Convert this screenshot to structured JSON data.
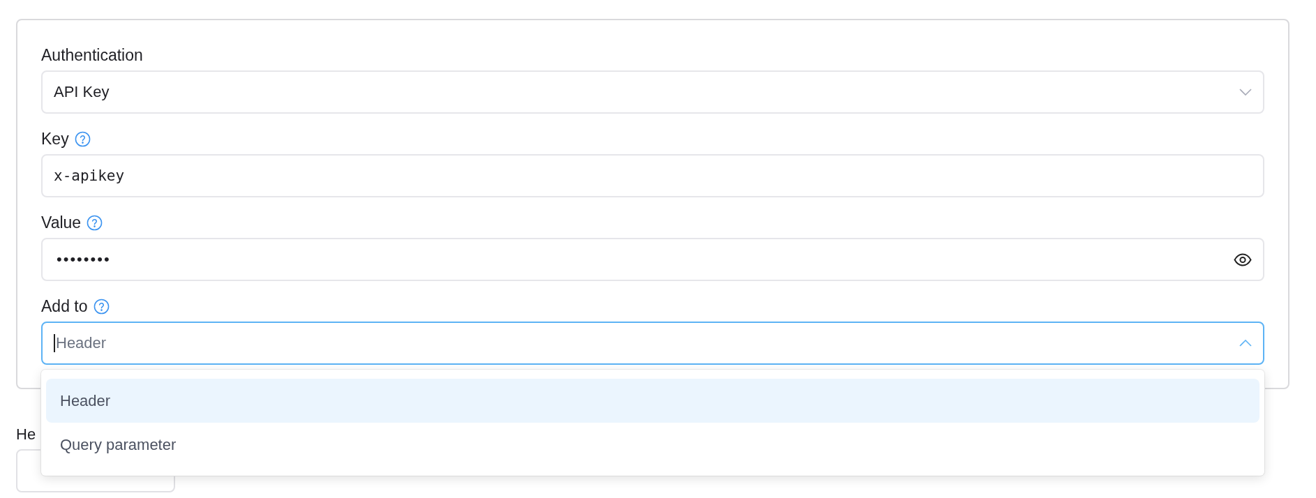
{
  "auth_form": {
    "fields": [
      {
        "kind": "select",
        "label": "Authentication",
        "help": false,
        "value": "API Key"
      },
      {
        "kind": "text",
        "label": "Key",
        "help": true,
        "value": "x-apikey"
      },
      {
        "kind": "password",
        "label": "Value",
        "help": true,
        "value": "••••••••"
      },
      {
        "kind": "combobox",
        "label": "Add to",
        "help": true,
        "placeholder": "Header",
        "expanded": true,
        "options": [
          {
            "label": "Header",
            "selected": true
          },
          {
            "label": "Query parameter",
            "selected": false
          }
        ]
      }
    ]
  },
  "headers_section": {
    "label": "He"
  }
}
